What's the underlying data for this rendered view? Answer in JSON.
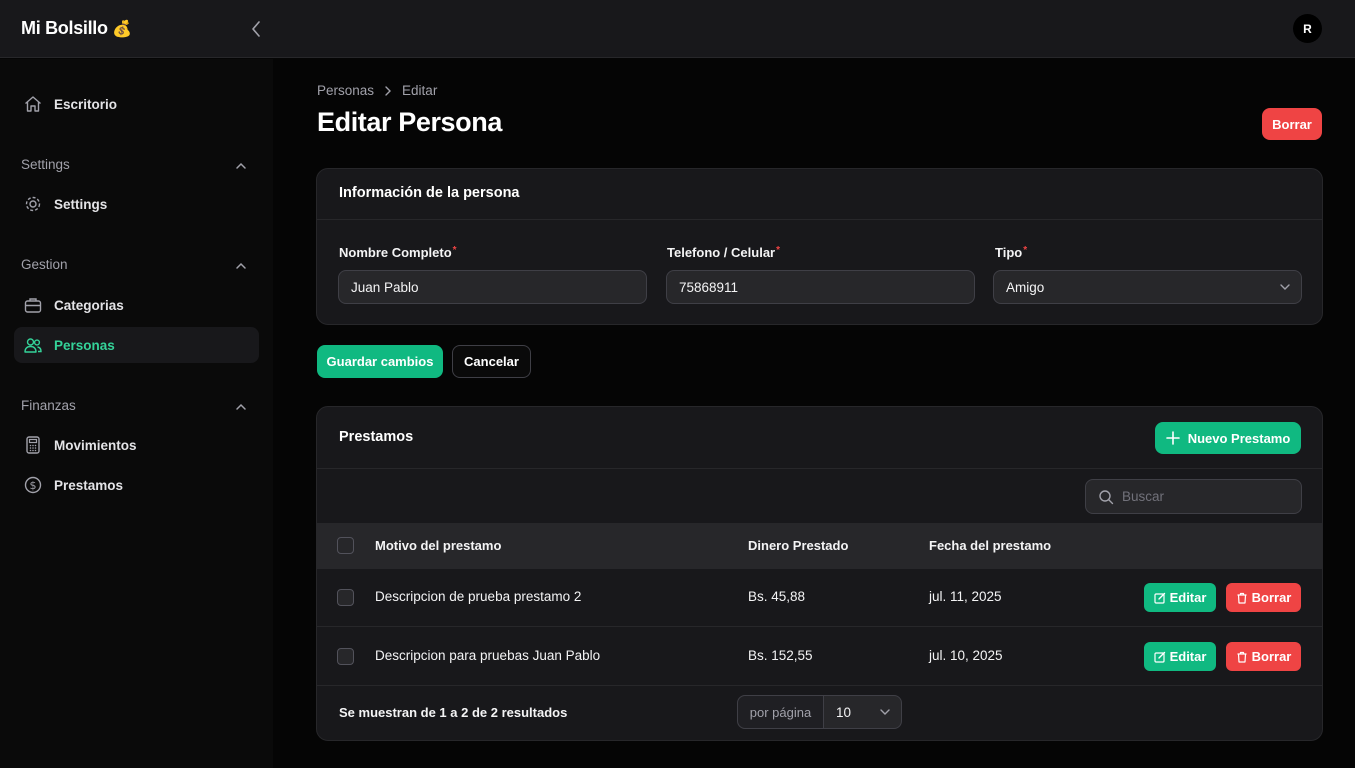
{
  "app": {
    "brand": "Mi Bolsillo",
    "brand_emoji": "💰",
    "avatar_initial": "R"
  },
  "sidebar": {
    "top_item": {
      "label": "Escritorio",
      "icon": "home-icon"
    },
    "groups": [
      {
        "label": "Settings",
        "items": [
          {
            "label": "Settings",
            "icon": "gear-icon"
          }
        ]
      },
      {
        "label": "Gestion",
        "items": [
          {
            "label": "Categorias",
            "icon": "briefcase-icon"
          },
          {
            "label": "Personas",
            "icon": "users-icon",
            "active": true
          }
        ]
      },
      {
        "label": "Finanzas",
        "items": [
          {
            "label": "Movimientos",
            "icon": "calculator-icon"
          },
          {
            "label": "Prestamos",
            "icon": "dollar-circle-icon"
          }
        ]
      }
    ]
  },
  "breadcrumb": {
    "parent": "Personas",
    "current": "Editar"
  },
  "page": {
    "title": "Editar Persona",
    "delete_label": "Borrar"
  },
  "form": {
    "section_title": "Información de la persona",
    "fields": [
      {
        "label": "Nombre Completo",
        "value": "Juan Pablo",
        "required": true
      },
      {
        "label": "Telefono / Celular",
        "value": "75868911",
        "required": true
      },
      {
        "label": "Tipo",
        "value": "Amigo",
        "required": true
      }
    ],
    "save_label": "Guardar cambios",
    "cancel_label": "Cancelar"
  },
  "loans": {
    "title": "Prestamos",
    "new_label": "Nuevo Prestamo",
    "search_placeholder": "Buscar",
    "columns": [
      "Motivo del prestamo",
      "Dinero Prestado",
      "Fecha del prestamo"
    ],
    "rows": [
      {
        "motivo": "Descripcion de prueba prestamo 2",
        "dinero": "Bs. 45,88",
        "fecha": "jul. 11, 2025"
      },
      {
        "motivo": "Descripcion para pruebas Juan Pablo",
        "dinero": "Bs. 152,55",
        "fecha": "jul. 10, 2025"
      }
    ],
    "edit_label": "Editar",
    "delete_label": "Borrar",
    "results_text": "Se muestran de 1 a 2 de 2 resultados",
    "per_page_label": "por página",
    "per_page_value": "10"
  },
  "colors": {
    "accent": "#10b981",
    "accent_text": "#34d399",
    "danger": "#ef4444",
    "background": "#050505",
    "card": "#18181b"
  }
}
